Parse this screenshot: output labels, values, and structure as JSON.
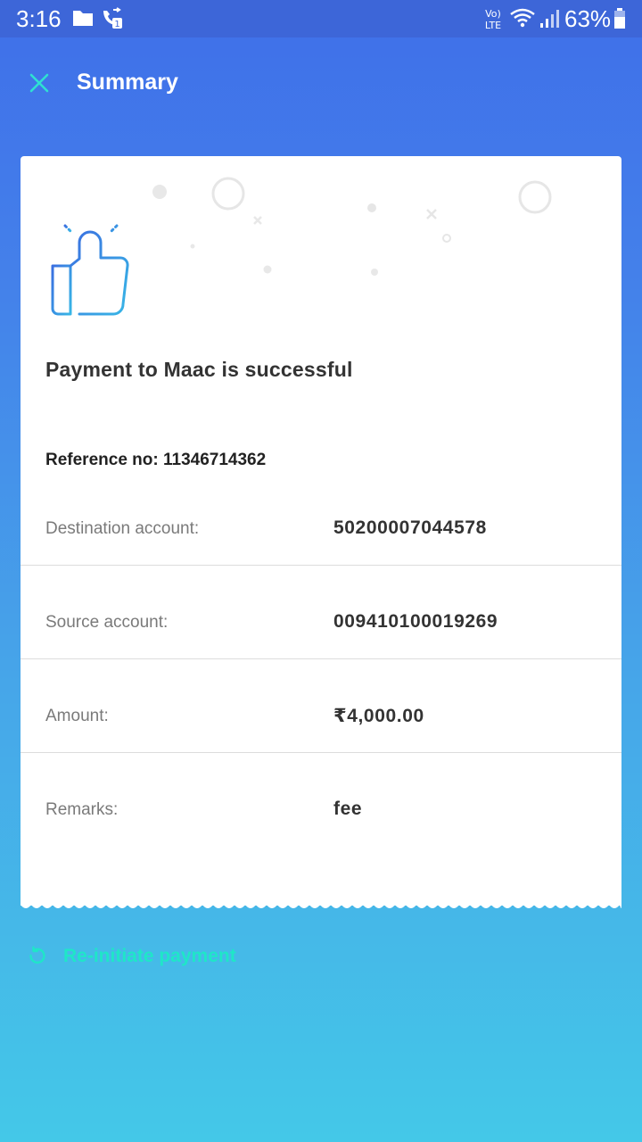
{
  "status_bar": {
    "time": "3:16",
    "battery": "63%",
    "network_label_top": "Vo)",
    "network_label_bottom": "LTE",
    "sim_badge": "1"
  },
  "header": {
    "title": "Summary",
    "close_icon": "close-icon"
  },
  "summary": {
    "title": "Payment to Maac is successful",
    "reference_label": "Reference no:",
    "reference_value": "11346714362",
    "rows": [
      {
        "label": "Destination account:",
        "value": "50200007044578"
      },
      {
        "label": "Source account:",
        "value": "009410100019269"
      },
      {
        "label": "Amount:",
        "value": "₹4,000.00"
      },
      {
        "label": "Remarks:",
        "value": "fee"
      }
    ]
  },
  "actions": {
    "reinitiate_label": "Re-initiate payment",
    "reinitiate_icon": "refresh-icon"
  },
  "colors": {
    "accent": "#1fe6c8",
    "status_bar": "#3d66d8",
    "background_top": "#3f6fe9",
    "background_bottom": "#44c8e8",
    "close_icon": "#2fe0d2"
  }
}
